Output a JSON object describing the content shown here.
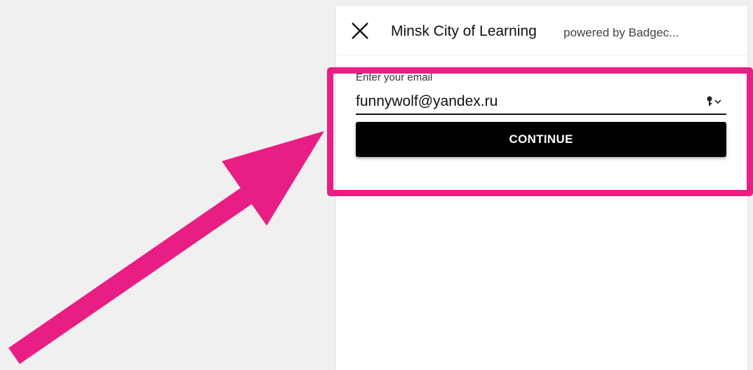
{
  "header": {
    "title": "Minsk City of Learning",
    "subtitle": "powered by Badgec..."
  },
  "form": {
    "email_label": "Enter your email",
    "email_value": "funnywolf@yandex.ru",
    "continue_label": "CONTINUE"
  },
  "icons": {
    "close": "close-icon",
    "password_key": "key-icon",
    "dropdown": "chevron-down-icon"
  },
  "colors": {
    "annotation": "#e91e84",
    "button_bg": "#000000",
    "page_bg": "#f0f0f0",
    "panel_bg": "#ffffff"
  }
}
